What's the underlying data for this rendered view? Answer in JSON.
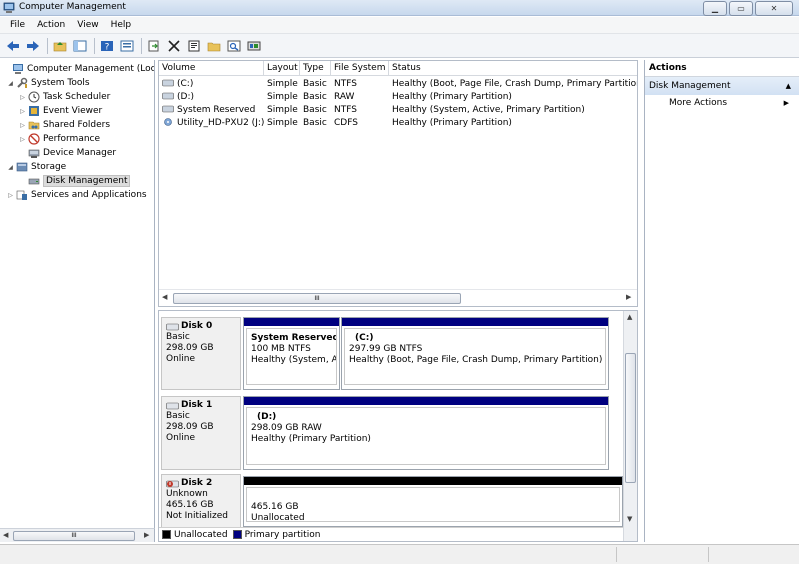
{
  "window": {
    "title": "Computer Management"
  },
  "menu": [
    "File",
    "Action",
    "View",
    "Help"
  ],
  "toolbar": {
    "icons": [
      "back-arrow-icon",
      "forward-arrow-icon",
      "up-folder-icon",
      "show-hide-tree-icon",
      "help-icon",
      "properties-icon",
      "export-icon",
      "delete-icon",
      "properties-sheet-icon",
      "open-icon",
      "search-icon",
      "rescan-icon"
    ]
  },
  "tree": {
    "root": "Computer Management (Local",
    "system_tools": "System Tools",
    "task_scheduler": "Task Scheduler",
    "event_viewer": "Event Viewer",
    "shared_folders": "Shared Folders",
    "performance": "Performance",
    "device_manager": "Device Manager",
    "storage": "Storage",
    "disk_management": "Disk Management",
    "services": "Services and Applications"
  },
  "volumes": {
    "headers": [
      "Volume",
      "Layout",
      "Type",
      "File System",
      "Status"
    ],
    "rows": [
      [
        "(C:)",
        "Simple",
        "Basic",
        "NTFS",
        "Healthy (Boot, Page File, Crash Dump, Primary Partition)"
      ],
      [
        "(D:)",
        "Simple",
        "Basic",
        "RAW",
        "Healthy (Primary Partition)"
      ],
      [
        "System Reserved",
        "Simple",
        "Basic",
        "NTFS",
        "Healthy (System, Active, Primary Partition)"
      ],
      [
        "Utility_HD-PXU2 (J:)",
        "Simple",
        "Basic",
        "CDFS",
        "Healthy (Primary Partition)"
      ]
    ]
  },
  "disks": [
    {
      "name": "Disk 0",
      "type": "Basic",
      "size": "298.09 GB",
      "status": "Online",
      "partitions": [
        {
          "title": "System Reserved",
          "size": "100 MB NTFS",
          "status": "Healthy (System, Ac"
        },
        {
          "title": "(C:)",
          "size": "297.99 GB NTFS",
          "status": "Healthy (Boot, Page File, Crash Dump, Primary Partition)"
        }
      ]
    },
    {
      "name": "Disk 1",
      "type": "Basic",
      "size": "298.09 GB",
      "status": "Online",
      "partitions": [
        {
          "title": "(D:)",
          "size": "298.09 GB RAW",
          "status": "Healthy (Primary Partition)"
        }
      ]
    },
    {
      "name": "Disk 2",
      "type": "Unknown",
      "size": "465.16 GB",
      "status": "Not Initialized",
      "partitions": [
        {
          "title": "",
          "size": "465.16 GB",
          "status": "Unallocated"
        }
      ]
    }
  ],
  "legend": [
    {
      "label": "Unallocated",
      "color": "#000000"
    },
    {
      "label": "Primary partition",
      "color": "#000080"
    }
  ],
  "actions": {
    "header": "Actions",
    "section": "Disk Management",
    "more": "More Actions"
  },
  "colors": {
    "primary_partition": "#000080",
    "unallocated": "#000000",
    "accent": "#d2e1f3"
  }
}
